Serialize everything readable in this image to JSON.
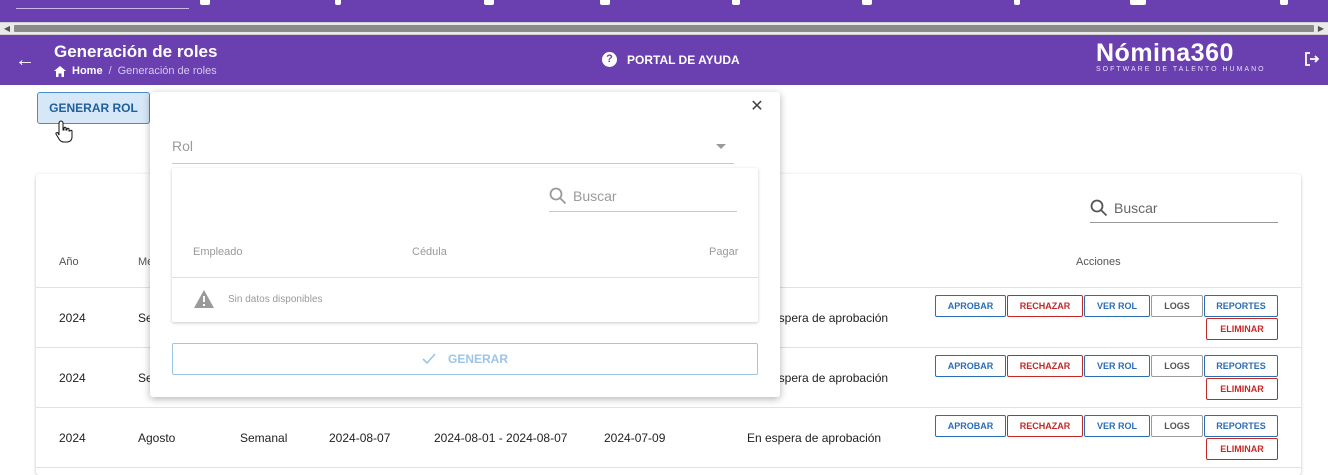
{
  "header": {
    "title": "Generación de roles",
    "breadcrumb_home": "Home",
    "breadcrumb_current": "Generación de roles",
    "help_label": "PORTAL DE AYUDA",
    "brand": "Nómina360",
    "brand_tagline": "SOFTWARE DE TALENTO HUMANO",
    "accent_color": "#6a3fb0"
  },
  "toolbar": {
    "generar_rol_label": "GENERAR ROL"
  },
  "table": {
    "search_placeholder": "Buscar",
    "headers": {
      "anio": "Año",
      "mes": "Me",
      "acciones": "Acciones"
    },
    "rows": [
      {
        "anio": "2024",
        "mes": "Se",
        "estado": "espera de aprobación"
      },
      {
        "anio": "2024",
        "mes": "Se",
        "estado": "espera de aprobación"
      },
      {
        "anio": "2024",
        "mes": "Agosto",
        "periodicidad": "Semanal",
        "fecha": "2024-08-07",
        "rango": "2024-08-01 - 2024-08-07",
        "fecha_corte": "2024-07-09",
        "estado": "En espera de aprobación"
      }
    ],
    "actions": {
      "aprobar": "APROBAR",
      "rechazar": "RECHAZAR",
      "ver_rol": "VER ROL",
      "logs": "LOGS",
      "reportes": "REPORTES",
      "eliminar": "ELIMINAR"
    }
  },
  "modal": {
    "rol_placeholder": "Rol",
    "search_placeholder": "Buscar",
    "headers": {
      "empleado": "Empleado",
      "cedula": "Cédula",
      "pagar": "Pagar"
    },
    "no_data": "Sin datos disponibles",
    "generar_label": "GENERAR"
  }
}
